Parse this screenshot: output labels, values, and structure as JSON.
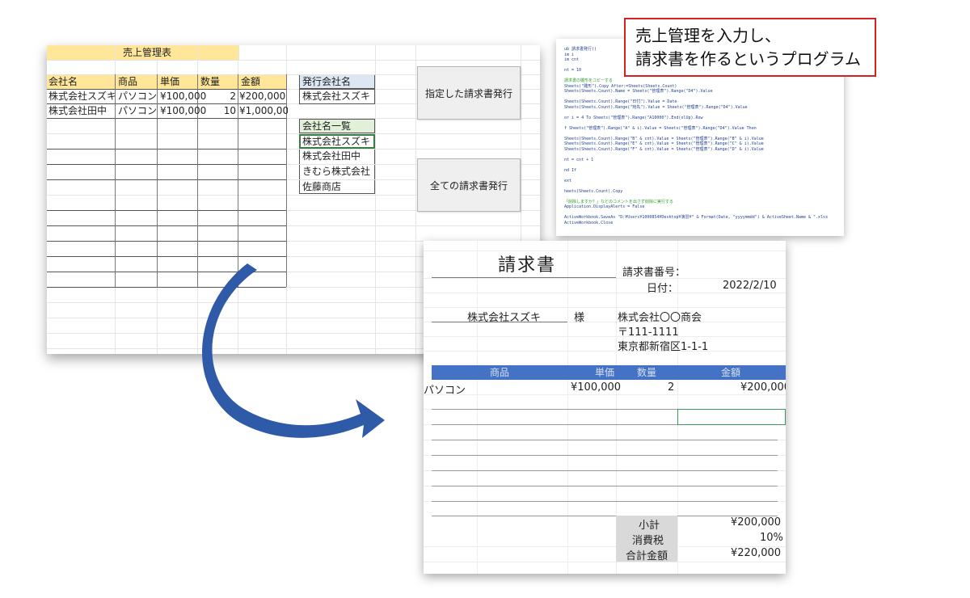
{
  "spreadsheet": {
    "title": "売上管理表",
    "headers": [
      "会社名",
      "商品",
      "単価",
      "数量",
      "金額"
    ],
    "rows": [
      [
        "株式会社スズキ",
        "パソコン",
        "¥100,000",
        "2",
        "¥200,000"
      ],
      [
        "株式会社田中",
        "パソコン",
        "¥100,000",
        "10",
        "¥1,000,000"
      ]
    ],
    "issuer_label": "発行会社名",
    "issuer_value": "株式会社スズキ",
    "company_list_label": "会社名一覧",
    "company_list": [
      "株式会社スズキ",
      "株式会社田中",
      "きむら株式会社",
      "佐藤商店"
    ],
    "buttons": [
      "指定した請求書発行",
      "全ての請求書発行"
    ]
  },
  "callout": {
    "line1": "売上管理を入力し、",
    "line2": "請求書を作るというプログラム"
  },
  "code": {
    "lines": [
      {
        "text": "ub 請求書発行()",
        "comment": false
      },
      {
        "text": "im i",
        "comment": false
      },
      {
        "text": "im cnt",
        "comment": false
      },
      {
        "text": "",
        "comment": false
      },
      {
        "text": "nt = 10",
        "comment": false
      },
      {
        "text": "",
        "comment": false
      },
      {
        "text": "請求書の雛形をコピーする",
        "comment": true
      },
      {
        "text": "  Sheets(\"雛形\").Copy After:=Sheets(Sheets.Count)",
        "comment": false
      },
      {
        "text": "  Sheets(Sheets.Count).Name = Sheets(\"管理表\").Range(\"D4\").Value",
        "comment": false
      },
      {
        "text": "",
        "comment": false
      },
      {
        "text": "  Sheets(Sheets.Count).Range(\"日付\").Value = Date",
        "comment": false
      },
      {
        "text": "  Sheets(Sheets.Count).Range(\"宛先\").Value = Sheets(\"管理表\").Range(\"D4\").Value",
        "comment": false
      },
      {
        "text": "",
        "comment": false
      },
      {
        "text": "or i = 4 To Sheets(\"管理表\").Range(\"A10000\").End(xlUp).Row",
        "comment": false
      },
      {
        "text": "",
        "comment": false
      },
      {
        "text": "f Sheets(\"管理表\").Range(\"A\" & i).Value = Sheets(\"管理表\").Range(\"D4\").Value Then",
        "comment": false
      },
      {
        "text": "",
        "comment": false
      },
      {
        "text": "  Sheets(Sheets.Count).Range(\"B\" & cnt).Value = Sheets(\"管理表\").Range(\"B\" & i).Value",
        "comment": false
      },
      {
        "text": "  Sheets(Sheets.Count).Range(\"E\" & cnt).Value = Sheets(\"管理表\").Range(\"C\" & i).Value",
        "comment": false
      },
      {
        "text": "  Sheets(Sheets.Count).Range(\"F\" & cnt).Value = Sheets(\"管理表\").Range(\"D\" & i).Value",
        "comment": false
      },
      {
        "text": "",
        "comment": false
      },
      {
        "text": "nt = cnt + 1",
        "comment": false
      },
      {
        "text": "",
        "comment": false
      },
      {
        "text": "nd If",
        "comment": false
      },
      {
        "text": "",
        "comment": false
      },
      {
        "text": "ext",
        "comment": false
      },
      {
        "text": "",
        "comment": false
      },
      {
        "text": "heets(Sheets.Count).Copy",
        "comment": false
      },
      {
        "text": "",
        "comment": false
      },
      {
        "text": "「削除しますか？」などのコメントを出さず削除に実行する",
        "comment": true
      },
      {
        "text": "  Application.DisplayAlerts = False",
        "comment": false
      },
      {
        "text": "",
        "comment": false
      },
      {
        "text": "  ActiveWorkbook.SaveAs \"D:¥Users¥1000854¥Desktop¥演習¥\" & Format(Date, \"yyyymmdd\") & ActiveSheet.Name & \".xlsx",
        "comment": false
      },
      {
        "text": "  ActiveWorkbook.Close",
        "comment": false
      }
    ]
  },
  "invoice": {
    "title": "請求書",
    "number_label": "請求書番号：",
    "date_label": "日付：",
    "date_value": "2022/2/10",
    "recipient": "株式会社スズキ",
    "honorific": "様",
    "sender_name": "株式会社〇〇商会",
    "sender_zip": "〒111-1111",
    "sender_address": "東京都新宿区1-1-1",
    "columns": [
      "商品",
      "単価",
      "数量",
      "金額"
    ],
    "items": [
      {
        "product": "パソコン",
        "unit_price": "¥100,000",
        "qty": "2",
        "amount": "¥200,000"
      }
    ],
    "subtotal_label": "小計",
    "subtotal_value": "¥200,000",
    "tax_label": "消費税",
    "tax_value": "10%",
    "total_label": "合計金額",
    "total_value": "¥220,000"
  },
  "colors": {
    "header_yellow": "#ffe699",
    "header_blue": "#dde7f3",
    "header_green": "#e2efd9",
    "invoice_header": "#4472c4",
    "callout_border": "#d32020",
    "arrow": "#2f5aa8"
  },
  "icons": {
    "flow_arrow": "curved-arrow-icon"
  }
}
